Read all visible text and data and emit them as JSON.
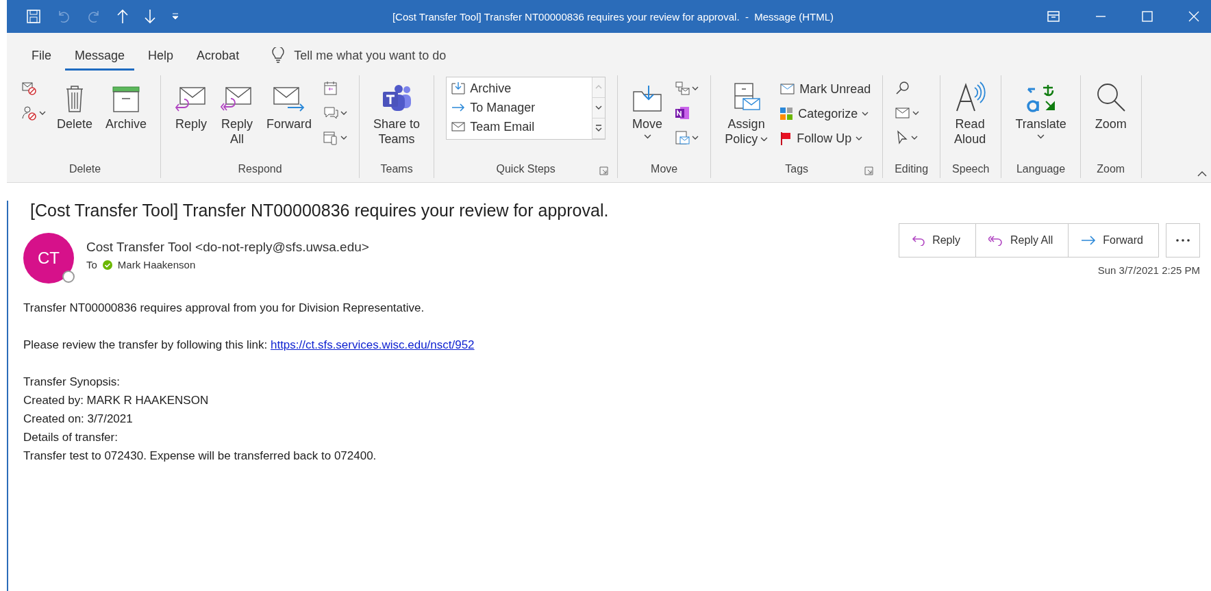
{
  "window": {
    "title": "[Cost Transfer Tool] Transfer NT00000836 requires your review for approval.  -  Message (HTML)"
  },
  "tabs": [
    {
      "label": "File",
      "selected": false
    },
    {
      "label": "Message",
      "selected": true
    },
    {
      "label": "Help",
      "selected": false
    },
    {
      "label": "Acrobat",
      "selected": false
    }
  ],
  "tell_me": {
    "placeholder": "Tell me what you want to do"
  },
  "ribbon": [
    {
      "label": "Delete",
      "items": [
        {
          "kind": "icon_stack",
          "dropdowns": [
            false,
            true
          ]
        },
        {
          "kind": "large",
          "label": [
            "Delete"
          ]
        },
        {
          "kind": "large",
          "label": [
            "Archive"
          ]
        }
      ]
    },
    {
      "label": "Respond",
      "items": [
        {
          "kind": "large",
          "label": [
            "Reply"
          ]
        },
        {
          "kind": "large",
          "label": [
            "Reply",
            "All"
          ]
        },
        {
          "kind": "large",
          "label": [
            "Forward"
          ]
        },
        {
          "kind": "icon_stack",
          "dropdowns": [
            false,
            true,
            true
          ]
        }
      ]
    },
    {
      "label": "Teams",
      "items": [
        {
          "kind": "large",
          "label": [
            "Share to",
            "Teams"
          ]
        }
      ]
    },
    {
      "label": "Quick Steps",
      "launcher": true,
      "items": [
        {
          "kind": "gallery",
          "entries": [
            "Archive",
            "To Manager",
            "Team Email"
          ]
        }
      ]
    },
    {
      "label": "Move",
      "items": [
        {
          "kind": "large",
          "label": [
            "Move"
          ],
          "dropdown": true
        },
        {
          "kind": "icon_stack",
          "dropdowns": [
            true,
            false,
            true
          ]
        }
      ]
    },
    {
      "label": "Tags",
      "launcher": true,
      "items": [
        {
          "kind": "large",
          "label": [
            "Assign",
            "Policy"
          ],
          "dropdown": true
        },
        {
          "kind": "small_list",
          "entries": [
            {
              "label": "Mark Unread",
              "dropdown": false
            },
            {
              "label": "Categorize",
              "dropdown": true
            },
            {
              "label": "Follow Up",
              "dropdown": true
            }
          ]
        }
      ]
    },
    {
      "label": "Editing",
      "items": [
        {
          "kind": "icon_stack",
          "dropdowns": [
            false,
            true,
            true
          ]
        }
      ]
    },
    {
      "label": "Speech",
      "items": [
        {
          "kind": "large",
          "label": [
            "Read",
            "Aloud"
          ]
        }
      ]
    },
    {
      "label": "Language",
      "items": [
        {
          "kind": "large",
          "label": [
            "Translate"
          ],
          "dropdown": true
        }
      ]
    },
    {
      "label": "Zoom",
      "items": [
        {
          "kind": "large",
          "label": [
            "Zoom"
          ]
        }
      ]
    }
  ],
  "message": {
    "subject": "[Cost Transfer Tool] Transfer NT00000836 requires your review for approval.",
    "sender": {
      "initials": "CT",
      "name": "Cost Transfer Tool <do-not-reply@sfs.uwsa.edu>"
    },
    "to_label": "To",
    "recipient": "Mark Haakenson",
    "actions": [
      "Reply",
      "Reply All",
      "Forward"
    ],
    "date": "Sun 3/7/2021 2:25 PM"
  },
  "body": [
    {
      "kind": "text",
      "lines": [
        "Transfer NT00000836 requires approval from you for Division Representative."
      ]
    },
    {
      "kind": "link",
      "text": "Please review the transfer by following this link: ",
      "link": "https://ct.sfs.services.wisc.edu/nsct/952"
    },
    {
      "kind": "text",
      "lines": [
        "Transfer Synopsis:",
        "Created by: MARK R HAAKENSON",
        "Created on: 3/7/2021",
        "Details of transfer:",
        "Transfer test to 072430. Expense will be transferred back to 072400."
      ]
    }
  ]
}
